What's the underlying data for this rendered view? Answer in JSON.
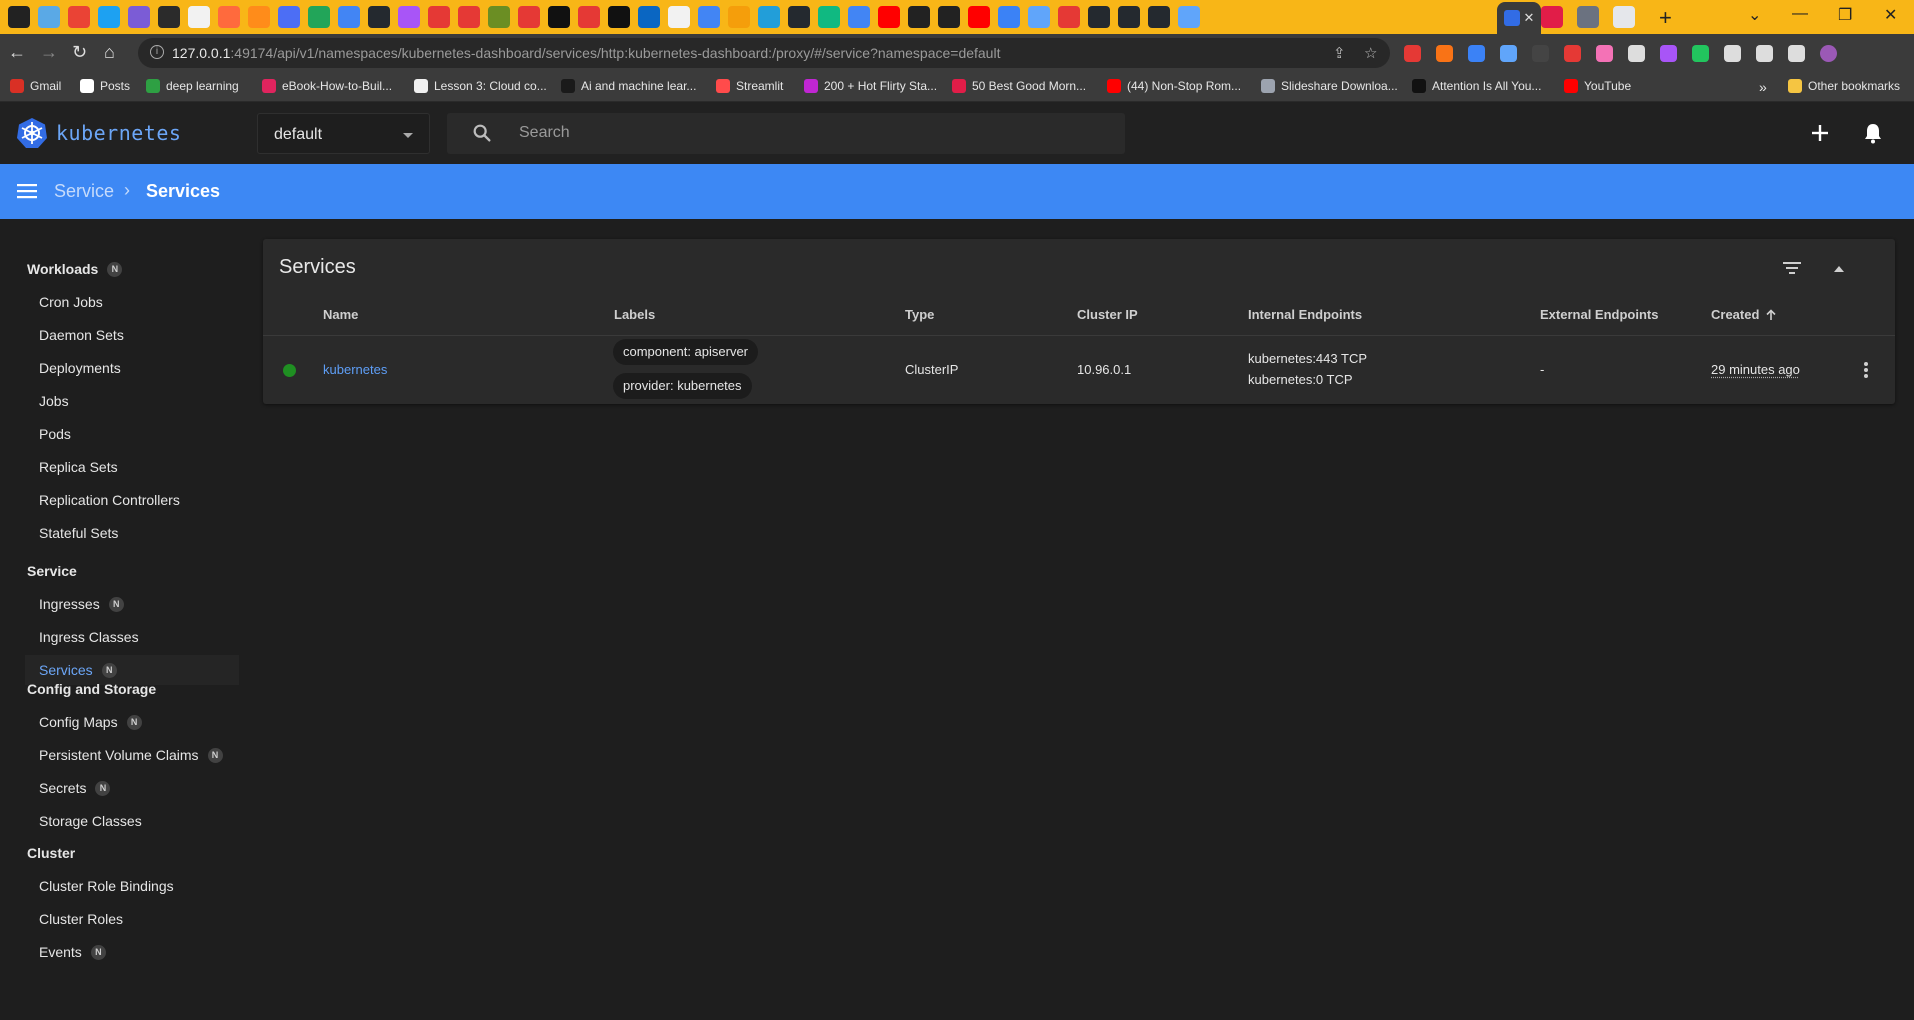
{
  "browser": {
    "address": {
      "host": "127.0.0.1",
      "path": ":49174/api/v1/namespaces/kubernetes-dashboard/services/http:kubernetes-dashboard:/proxy/#/service?namespace=default"
    },
    "bookmarks": [
      {
        "label": "Gmail",
        "color": "#d93025"
      },
      {
        "label": "Posts",
        "color": "#ffffff"
      },
      {
        "label": "deep learning",
        "color": "#2ea043"
      },
      {
        "label": "eBook-How-to-Buil...",
        "color": "#e0245e"
      },
      {
        "label": "Lesson 3: Cloud co...",
        "color": "#f0f0f0"
      },
      {
        "label": "Ai and machine lear...",
        "color": "#1a1a1a"
      },
      {
        "label": "Streamlit",
        "color": "#ff4b4b"
      },
      {
        "label": "200 + Hot Flirty Sta...",
        "color": "#c026d3"
      },
      {
        "label": "50 Best Good Morn...",
        "color": "#e11d48"
      },
      {
        "label": "(44) Non-Stop Rom...",
        "color": "#ff0000"
      },
      {
        "label": "Slideshare Downloa...",
        "color": "#9ca3af"
      },
      {
        "label": "Attention Is All You...",
        "color": "#111111"
      },
      {
        "label": "YouTube",
        "color": "#ff0000"
      }
    ],
    "bookmarks_overflow": "»",
    "other_bookmarks": "Other bookmarks"
  },
  "header": {
    "brand": "kubernetes",
    "namespace": "default",
    "search_placeholder": "Search"
  },
  "breadcrumb": {
    "parent": "Service",
    "separator": "›",
    "current": "Services"
  },
  "sidebar": {
    "sections": [
      {
        "title": "Workloads",
        "badge": "N",
        "items": [
          {
            "label": "Cron Jobs"
          },
          {
            "label": "Daemon Sets"
          },
          {
            "label": "Deployments"
          },
          {
            "label": "Jobs"
          },
          {
            "label": "Pods"
          },
          {
            "label": "Replica Sets"
          },
          {
            "label": "Replication Controllers"
          },
          {
            "label": "Stateful Sets"
          }
        ]
      },
      {
        "title": "Service",
        "items": [
          {
            "label": "Ingresses",
            "badge": "N"
          },
          {
            "label": "Ingress Classes"
          },
          {
            "label": "Services",
            "badge": "N",
            "active": true
          }
        ]
      },
      {
        "title": "Config and Storage",
        "items": [
          {
            "label": "Config Maps",
            "badge": "N"
          },
          {
            "label": "Persistent Volume Claims",
            "badge": "N"
          },
          {
            "label": "Secrets",
            "badge": "N"
          },
          {
            "label": "Storage Classes"
          }
        ]
      },
      {
        "title": "Cluster",
        "items": [
          {
            "label": "Cluster Role Bindings"
          },
          {
            "label": "Cluster Roles"
          },
          {
            "label": "Events",
            "badge": "N"
          }
        ]
      }
    ]
  },
  "card": {
    "title": "Services",
    "columns": {
      "name": "Name",
      "labels": "Labels",
      "type": "Type",
      "cluster_ip": "Cluster IP",
      "internal_endpoints": "Internal Endpoints",
      "external_endpoints": "External Endpoints",
      "created": "Created"
    },
    "rows": [
      {
        "status": "running",
        "name": "kubernetes",
        "labels": [
          "component: apiserver",
          "provider: kubernetes"
        ],
        "type": "ClusterIP",
        "cluster_ip": "10.96.0.1",
        "internal_endpoints": [
          "kubernetes:443 TCP",
          "kubernetes:0 TCP"
        ],
        "external_endpoints": "-",
        "created": "29 minutes ago"
      }
    ]
  },
  "colors": {
    "accent": "#3d88f4",
    "link": "#5e9ef6",
    "status_ok": "#1f8f22",
    "chrome_tabstrip": "#f8b617"
  }
}
